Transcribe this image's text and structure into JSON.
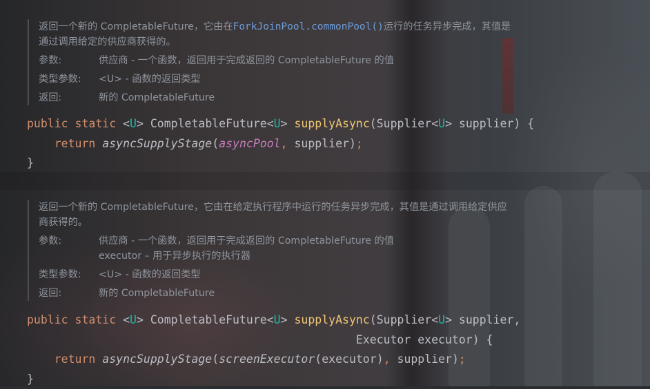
{
  "doc1": {
    "desc_pre": "返回一个新的 CompletableFuture，它由在",
    "desc_link": "ForkJoinPool.commonPool()",
    "desc_post": "运行的任务异步完成，其值是",
    "desc_line2": "通过调用给定的供应商获得的。",
    "params_label": "参数:",
    "params_value": "供应商 - 一个函数，返回用于完成返回的 CompletableFuture 的值",
    "type_params_label": "类型参数:",
    "type_params_value": "<U> - 函数的返回类型",
    "returns_label": "返回:",
    "returns_value": "新的 CompletableFuture"
  },
  "code1": {
    "kw_public": "public",
    "kw_static": "static",
    "lt": "<",
    "gen_u": "U",
    "gt": ">",
    "ret_type": "CompletableFuture",
    "method": "supplyAsync",
    "param_type": "Supplier",
    "param_name": "supplier",
    "open": ") {",
    "kw_return": "return",
    "call": "asyncSupplyStage",
    "field": "asyncPool",
    "args_rest": "supplier",
    "close_stmt": ");",
    "close_brace": "}"
  },
  "doc2": {
    "desc_line1": "返回一个新的 CompletableFuture，它由在给定执行程序中运行的任务异步完成，其值是通过调用给定供应",
    "desc_line2": "商获得的。",
    "params_label": "参数:",
    "params_value1": "供应商 - 一个函数，返回用于完成返回的 CompletableFuture 的值",
    "params_value2": "executor – 用于异步执行的执行器",
    "type_params_label": "类型参数:",
    "type_params_value": "<U> - 函数的返回类型",
    "returns_label": "返回:",
    "returns_value": "新的 CompletableFuture"
  },
  "code2": {
    "kw_public": "public",
    "kw_static": "static",
    "gen_u": "U",
    "ret_type": "CompletableFuture",
    "method": "supplyAsync",
    "param_type": "Supplier",
    "param_name": "supplier,",
    "param2": "Executor executor",
    "open": ") {",
    "kw_return": "return",
    "call": "asyncSupplyStage",
    "inner_call": "screenExecutor",
    "inner_arg": "executor",
    "args_rest": "supplier",
    "close_stmt": ");",
    "close_brace": "}"
  }
}
